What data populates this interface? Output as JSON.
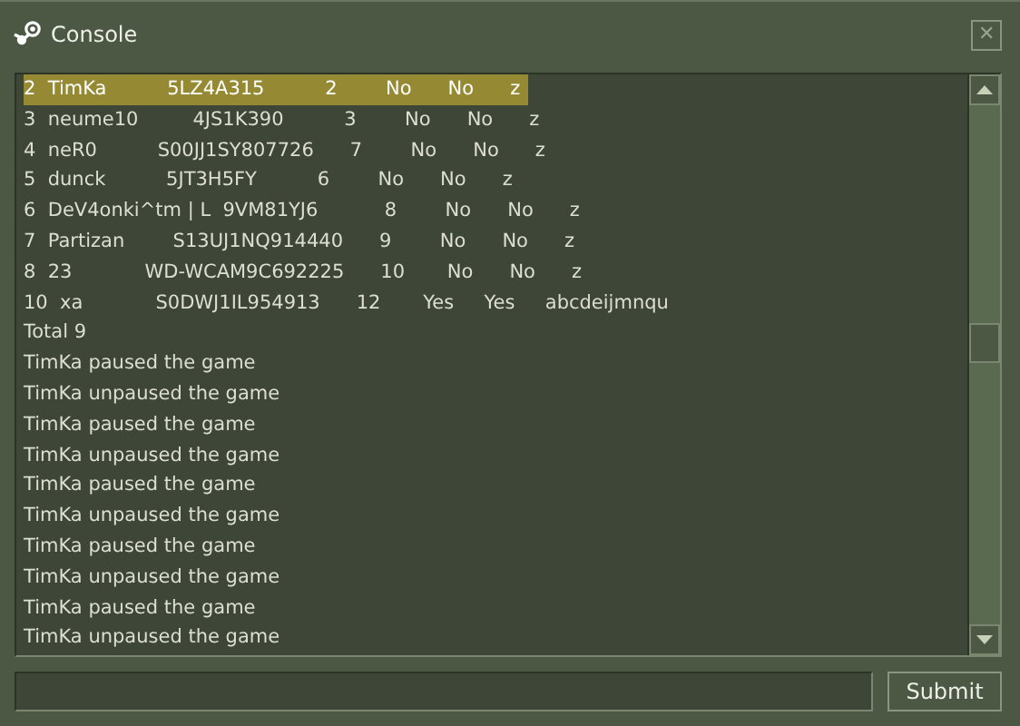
{
  "window": {
    "title": "Console",
    "close": "✕"
  },
  "lines": [
    {
      "text": "2  TimKa          5LZ4A315          2        No      No      z",
      "selected": true
    },
    {
      "text": "3  neume10         4JS1K390          3        No      No      z",
      "selected": false
    },
    {
      "text": "4  neR0          S00JJ1SY807726      7        No      No      z",
      "selected": false
    },
    {
      "text": "5  dunck          5JT3H5FY          6        No      No      z",
      "selected": false
    },
    {
      "text": "6  DeV4onki^tm | L  9VM81YJ6           8        No      No      z",
      "selected": false
    },
    {
      "text": "7  Partizan        S13UJ1NQ914440      9        No      No      z",
      "selected": false
    },
    {
      "text": "8  23            WD-WCAM9C692225      10       No      No      z",
      "selected": false
    },
    {
      "text": "10  xa            S0DWJ1IL954913      12       Yes     Yes     abcdeijmnqu",
      "selected": false
    },
    {
      "text": "Total 9",
      "selected": false
    },
    {
      "text": "TimKa paused the game",
      "selected": false
    },
    {
      "text": "TimKa unpaused the game",
      "selected": false
    },
    {
      "text": "TimKa paused the game",
      "selected": false
    },
    {
      "text": "TimKa unpaused the game",
      "selected": false
    },
    {
      "text": "TimKa paused the game",
      "selected": false
    },
    {
      "text": "TimKa unpaused the game",
      "selected": false
    },
    {
      "text": "TimKa paused the game",
      "selected": false
    },
    {
      "text": "TimKa unpaused the game",
      "selected": false
    },
    {
      "text": "TimKa paused the game",
      "selected": false
    },
    {
      "text": "TimKa unpaused the game",
      "selected": false
    }
  ],
  "submit": "Submit"
}
